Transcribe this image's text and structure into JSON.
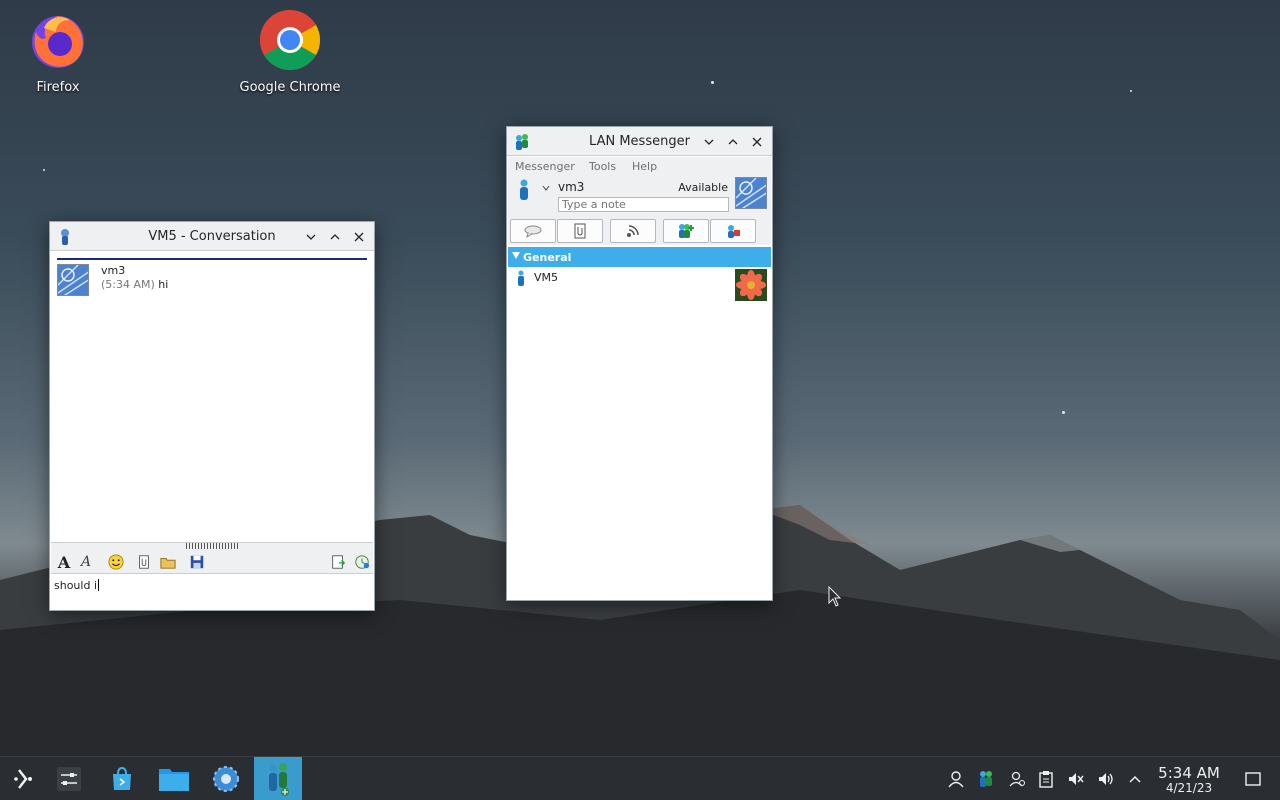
{
  "desktop": {
    "icons": [
      {
        "label": "Firefox",
        "icon": "firefox-icon"
      },
      {
        "label": "Google Chrome",
        "icon": "chrome-icon"
      }
    ]
  },
  "conversation": {
    "title": "VM5 - Conversation",
    "messages": [
      {
        "sender": "vm3",
        "time": "(5:34 AM)",
        "text": "hi"
      }
    ],
    "input_value": "should i",
    "toolbar": [
      "font-icon",
      "font-color-icon",
      "smiley-icon",
      "attach-file-icon",
      "folder-icon",
      "save-icon",
      "history-icon",
      "send-file-icon"
    ]
  },
  "messenger": {
    "title": "LAN Messenger",
    "menu": [
      "Messenger",
      "Tools",
      "Help"
    ],
    "user": {
      "name": "vm3",
      "status": "Available",
      "note_placeholder": "Type a note"
    },
    "toolbar": [
      "chat-icon",
      "file-icon",
      "broadcast-icon",
      "add-contact-icon",
      "tools-icon"
    ],
    "groups": [
      {
        "name": "General",
        "contacts": [
          {
            "name": "VM5"
          }
        ]
      }
    ]
  },
  "taskbar": {
    "apps": [
      "launcher-icon",
      "settings-panel-icon",
      "discover-icon",
      "files-icon",
      "system-settings-icon",
      "lan-messenger-icon"
    ],
    "clock": {
      "time": "5:34 AM",
      "date": "4/21/23"
    }
  },
  "colors": {
    "accent": "#3daee9",
    "titlebar": "#eff0f1",
    "taskbar": "#2a2e32"
  }
}
